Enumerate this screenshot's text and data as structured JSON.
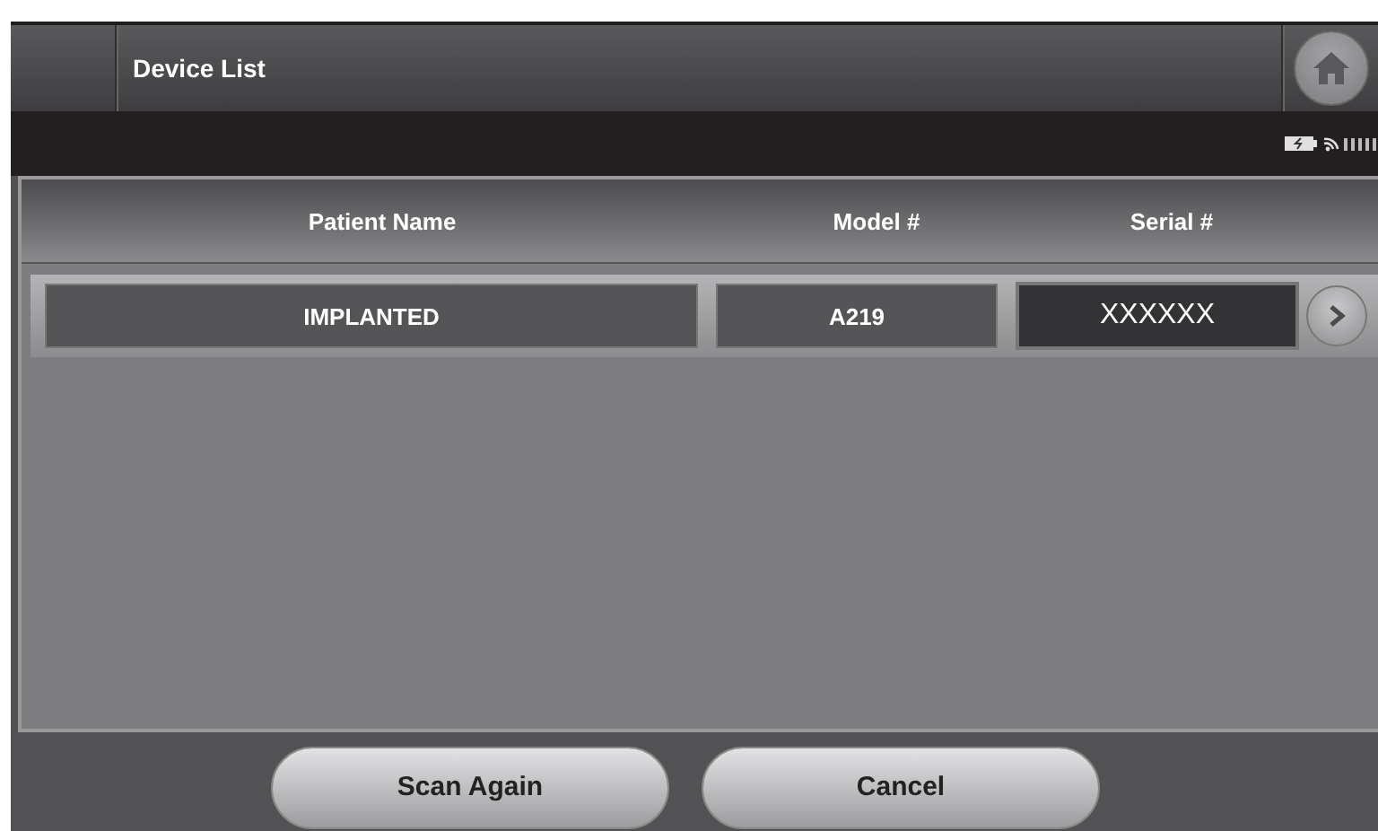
{
  "header": {
    "title": "Device List"
  },
  "table": {
    "columns": [
      "Patient Name",
      "Model #",
      "Serial #"
    ],
    "rows": [
      {
        "cells": [
          "IMPLANTED",
          "A219",
          "XXXXXX"
        ]
      }
    ]
  },
  "buttons": [
    "Scan Again",
    "Cancel"
  ]
}
